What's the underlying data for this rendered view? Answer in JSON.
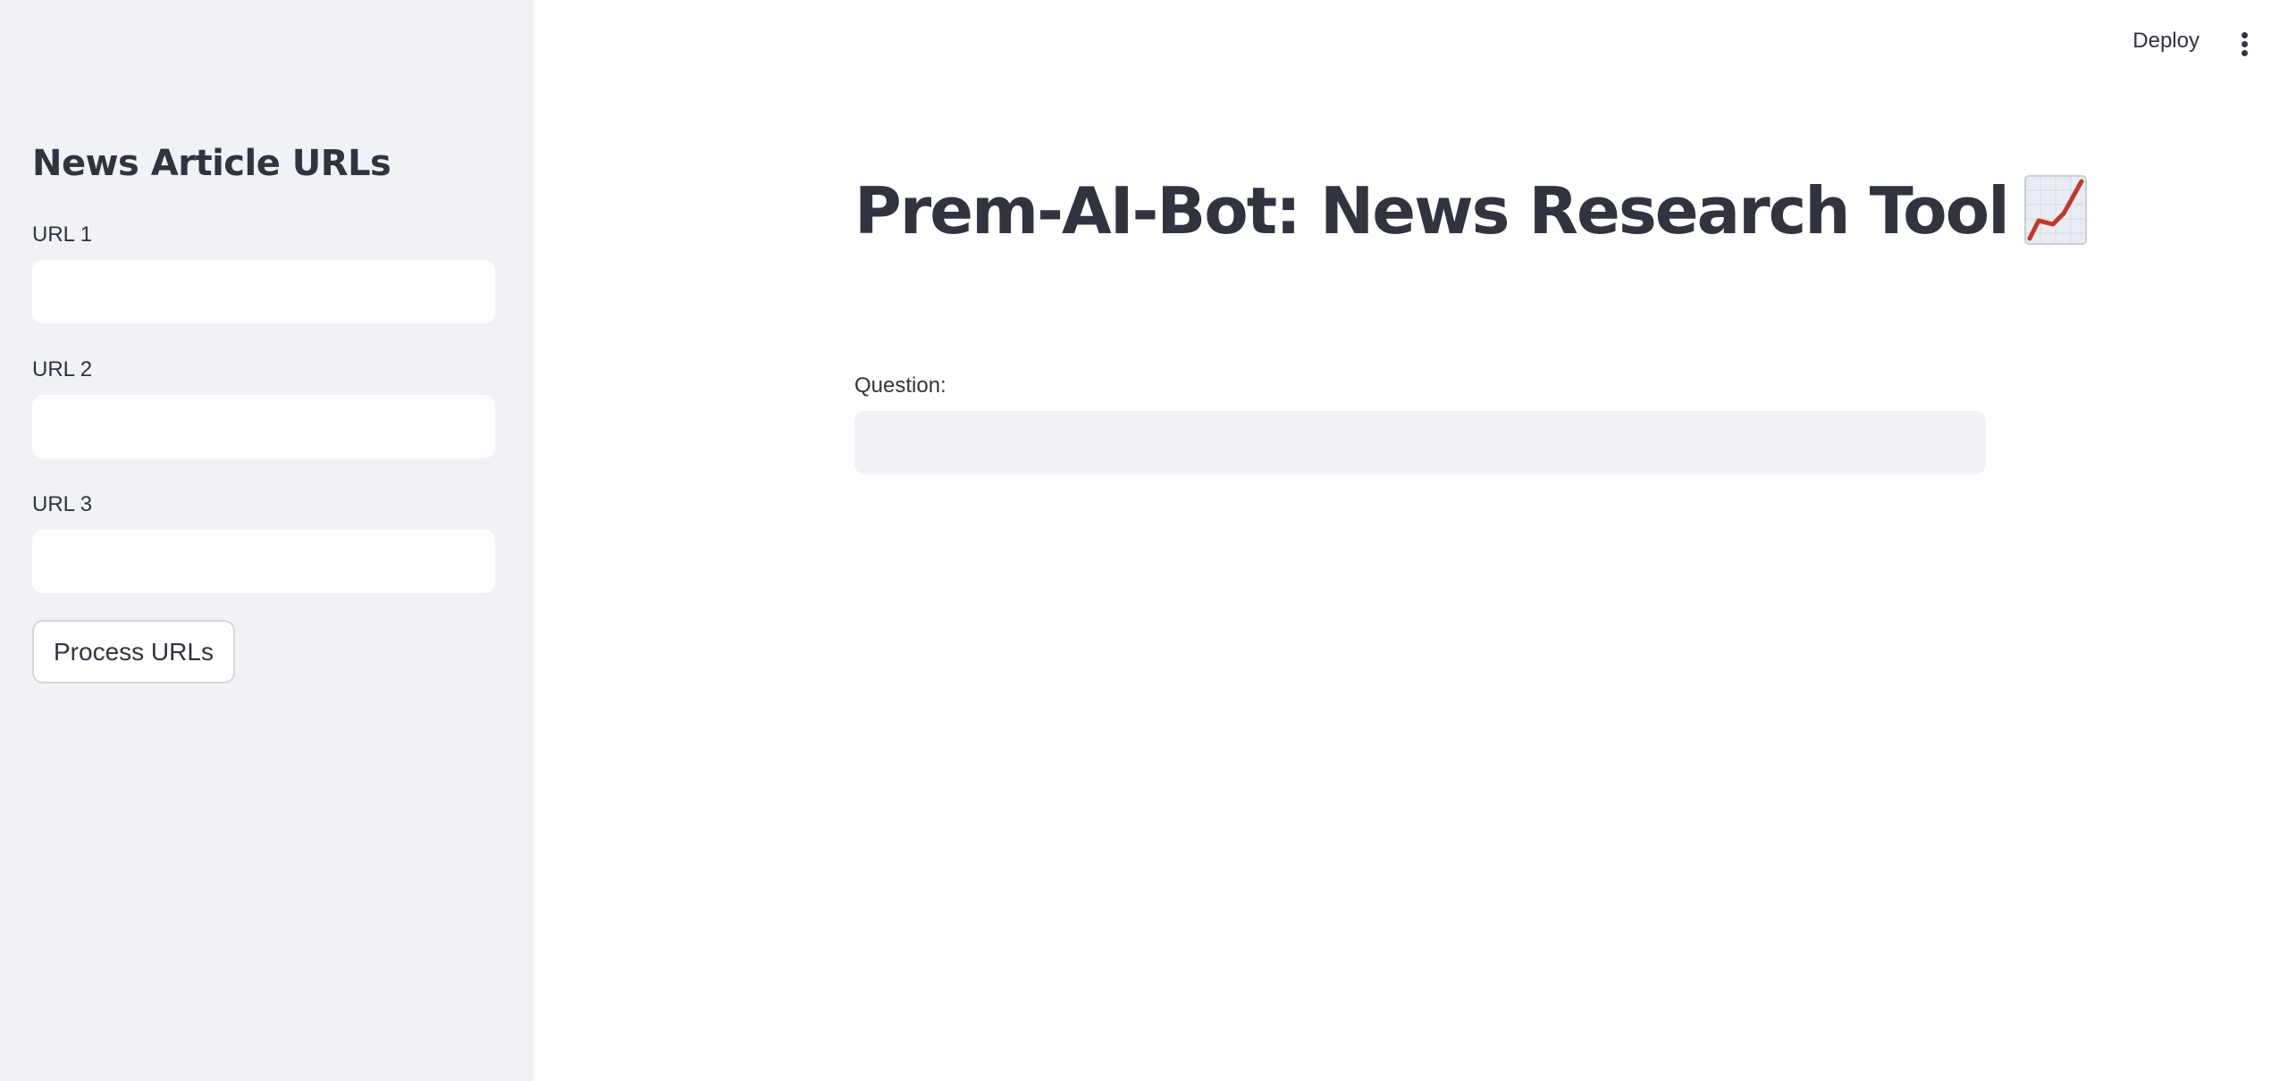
{
  "header": {
    "deploy_label": "Deploy",
    "menu_icon": "vertical-dots-icon"
  },
  "sidebar": {
    "title": "News Article URLs",
    "fields": [
      {
        "label": "URL 1",
        "value": ""
      },
      {
        "label": "URL 2",
        "value": ""
      },
      {
        "label": "URL 3",
        "value": ""
      }
    ],
    "process_button_label": "Process URLs"
  },
  "main": {
    "title": "Prem-AI-Bot: News Research Tool",
    "title_icon": "chart-increasing-icon",
    "question_label": "Question:",
    "question_value": ""
  },
  "colors": {
    "sidebar_bg": "#f0f2f6",
    "text": "#31333f",
    "input_bg_main": "#f0f2f6",
    "input_bg_sidebar": "#ffffff",
    "chart_line": "#c0392b"
  }
}
